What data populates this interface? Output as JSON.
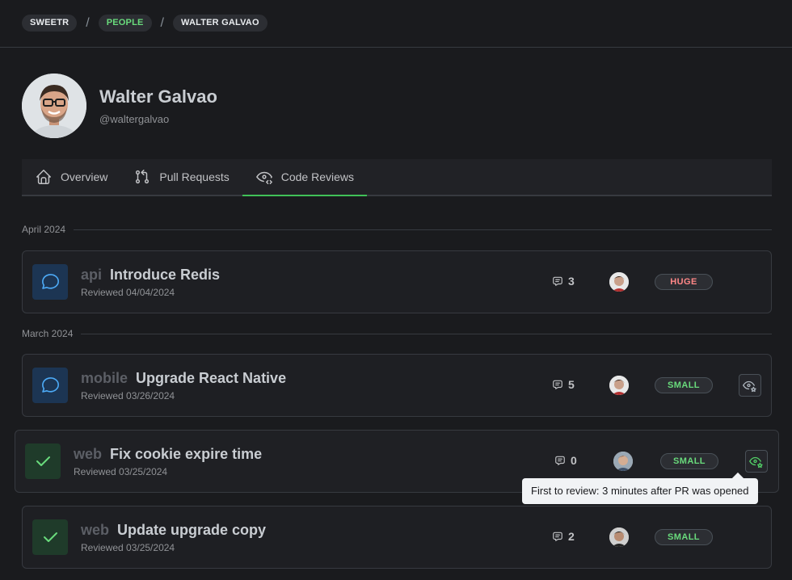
{
  "breadcrumb": [
    {
      "label": "SWEETR"
    },
    {
      "label": "PEOPLE"
    },
    {
      "label": "WALTER GALVAO"
    }
  ],
  "profile": {
    "name": "Walter Galvao",
    "handle": "@waltergalvao"
  },
  "tabs": [
    {
      "label": "Overview",
      "icon": "home-icon"
    },
    {
      "label": "Pull Requests",
      "icon": "git-pull-request-icon"
    },
    {
      "label": "Code Reviews",
      "icon": "eye-code-icon",
      "active": true
    }
  ],
  "groups": [
    {
      "month": "April 2024",
      "reviews": [
        {
          "status": "commented",
          "repo": "api",
          "title": "Introduce Redis",
          "reviewed": "Reviewed 04/04/2024",
          "comments": "3",
          "size": "HUGE",
          "first_review": false
        }
      ]
    },
    {
      "month": "March 2024",
      "reviews": [
        {
          "status": "commented",
          "repo": "mobile",
          "title": "Upgrade React Native",
          "reviewed": "Reviewed 03/26/2024",
          "comments": "5",
          "size": "SMALL",
          "first_review": true
        },
        {
          "status": "approved",
          "repo": "web",
          "title": "Fix cookie expire time",
          "reviewed": "Reviewed 03/25/2024",
          "comments": "0",
          "size": "SMALL",
          "first_review": true
        },
        {
          "status": "approved",
          "repo": "web",
          "title": "Update upgrade copy",
          "reviewed": "Reviewed 03/25/2024",
          "comments": "2",
          "size": "SMALL",
          "first_review": false
        }
      ]
    }
  ],
  "tooltip": "First to review: 3 minutes after PR was opened",
  "colors": {
    "accent": "#40c057",
    "huge": "#ff8787",
    "small": "#69db7c",
    "comment_status_bg": "#1c3553",
    "approved_status_bg": "#1f3b2a"
  }
}
